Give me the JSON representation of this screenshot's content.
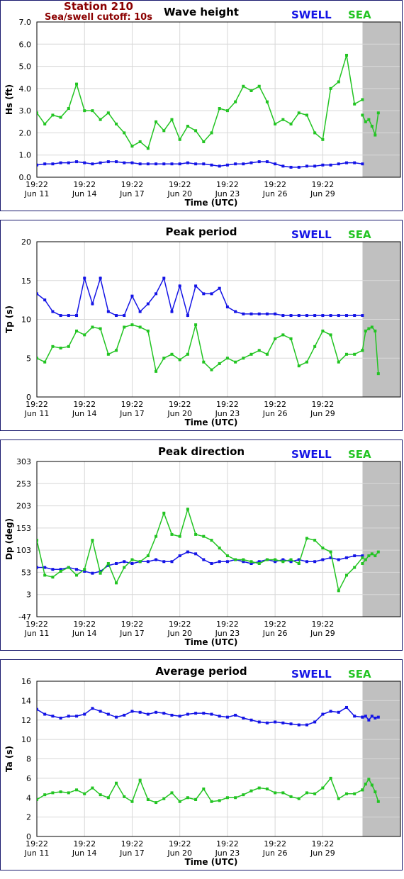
{
  "header": {
    "station": "Station 210",
    "cutoff": "Sea/swell cutoff: 10s"
  },
  "colors": {
    "swell": "#1414e6",
    "sea": "#22c422",
    "plot_bg": "#ffffff",
    "outside_bg": "#c0c0c0"
  },
  "legend": {
    "swell": "SWELL",
    "sea": "SEA"
  },
  "x_ticks": [
    {
      "time": "19:22",
      "date": "Jun 11"
    },
    {
      "time": "19:22",
      "date": "Jun 14"
    },
    {
      "time": "19:22",
      "date": "Jun 17"
    },
    {
      "time": "19:22",
      "date": "Jun 20"
    },
    {
      "time": "19:22",
      "date": "Jun 23"
    },
    {
      "time": "19:22",
      "date": "Jun 26"
    },
    {
      "time": "19:22",
      "date": "Jun 29"
    }
  ],
  "chart_data": [
    {
      "type": "line",
      "title": "Wave height",
      "ylabel": "Hs (ft)",
      "xlabel": "Time (UTC)",
      "ylim": [
        0,
        7
      ],
      "yticks": [
        "0.0",
        "1.0",
        "2.0",
        "3.0",
        "4.0",
        "5.0",
        "6.0",
        "7.0"
      ],
      "x": [
        0,
        0.5,
        1,
        1.5,
        2,
        2.5,
        3,
        3.5,
        4,
        4.5,
        5,
        5.5,
        6,
        6.5,
        7,
        7.5,
        8,
        8.5,
        9,
        9.5,
        10,
        10.5,
        11,
        11.5,
        12,
        12.5,
        13,
        13.5,
        14,
        14.5,
        15,
        15.5,
        16,
        16.5,
        17,
        17.5,
        18,
        18.5,
        19,
        19.5,
        20,
        20.5
      ],
      "series": [
        {
          "name": "SWELL",
          "values": [
            0.55,
            0.6,
            0.6,
            0.65,
            0.65,
            0.7,
            0.65,
            0.6,
            0.65,
            0.7,
            0.7,
            0.65,
            0.65,
            0.6,
            0.6,
            0.6,
            0.6,
            0.6,
            0.6,
            0.65,
            0.6,
            0.6,
            0.55,
            0.5,
            0.55,
            0.6,
            0.6,
            0.65,
            0.7,
            0.7,
            0.6,
            0.5,
            0.45,
            0.45,
            0.5,
            0.5,
            0.55,
            0.55,
            0.6,
            0.65,
            0.65,
            0.6
          ]
        },
        {
          "name": "SEA",
          "values": [
            2.9,
            2.4,
            2.8,
            2.7,
            3.1,
            4.2,
            3.0,
            3.0,
            2.6,
            2.9,
            2.4,
            2.0,
            1.4,
            1.6,
            1.3,
            2.5,
            2.1,
            2.6,
            1.7,
            2.3,
            2.1,
            1.6,
            2.0,
            3.1,
            3.0,
            3.4,
            4.1,
            3.9,
            4.1,
            3.4,
            2.4,
            2.6,
            2.4,
            2.9,
            2.8,
            2.0,
            1.7,
            4.0,
            4.3,
            5.5,
            3.3,
            3.5
          ]
        }
      ],
      "sea_tail": [
        2.8,
        2.5,
        2.6,
        2.3,
        1.9,
        2.9
      ]
    },
    {
      "type": "line",
      "title": "Peak period",
      "ylabel": "Tp (s)",
      "xlabel": "Time (UTC)",
      "ylim": [
        0,
        20
      ],
      "yticks": [
        "0",
        "5",
        "10",
        "15",
        "20"
      ],
      "x": [
        0,
        0.5,
        1,
        1.5,
        2,
        2.5,
        3,
        3.5,
        4,
        4.5,
        5,
        5.5,
        6,
        6.5,
        7,
        7.5,
        8,
        8.5,
        9,
        9.5,
        10,
        10.5,
        11,
        11.5,
        12,
        12.5,
        13,
        13.5,
        14,
        14.5,
        15,
        15.5,
        16,
        16.5,
        17,
        17.5,
        18,
        18.5,
        19,
        19.5,
        20,
        20.5
      ],
      "series": [
        {
          "name": "SWELL",
          "values": [
            13.3,
            12.5,
            11.0,
            10.5,
            10.5,
            10.5,
            15.3,
            12.0,
            15.3,
            11.0,
            10.5,
            10.5,
            13.0,
            11.0,
            12.0,
            13.3,
            15.3,
            11.0,
            14.3,
            10.5,
            14.3,
            13.3,
            13.3,
            14.0,
            11.6,
            11.0,
            10.7,
            10.7,
            10.7,
            10.7,
            10.7,
            10.5,
            10.5,
            10.5,
            10.5,
            10.5,
            10.5,
            10.5,
            10.5,
            10.5,
            10.5,
            10.5
          ]
        },
        {
          "name": "SEA",
          "values": [
            5.0,
            4.5,
            6.5,
            6.3,
            6.5,
            8.5,
            8.0,
            9.0,
            8.8,
            5.5,
            6.0,
            9.0,
            9.3,
            9.0,
            8.5,
            3.3,
            5.0,
            5.5,
            4.8,
            5.5,
            9.3,
            4.5,
            3.5,
            4.3,
            5.0,
            4.5,
            5.0,
            5.5,
            6.0,
            5.5,
            7.5,
            8.0,
            7.5,
            4.0,
            4.5,
            6.5,
            8.5,
            8.0,
            4.5,
            5.5,
            5.5,
            6.0
          ]
        }
      ],
      "sea_tail": [
        6.0,
        8.5,
        8.8,
        9.0,
        8.5,
        3.0
      ]
    },
    {
      "type": "line",
      "title": "Peak direction",
      "ylabel": "Dp (deg)",
      "xlabel": "Time (UTC)",
      "ylim": [
        -47,
        353
      ],
      "yticks": [
        "-47",
        "3",
        "53",
        "103",
        "153",
        "203",
        "253",
        "303"
      ],
      "x": [
        0,
        0.5,
        1,
        1.5,
        2,
        2.5,
        3,
        3.5,
        4,
        4.5,
        5,
        5.5,
        6,
        6.5,
        7,
        7.5,
        8,
        8.5,
        9,
        9.5,
        10,
        10.5,
        11,
        11.5,
        12,
        12.5,
        13,
        13.5,
        14,
        14.5,
        15,
        15.5,
        16,
        16.5,
        17,
        17.5,
        18,
        18.5,
        19,
        19.5,
        20,
        20.5
      ],
      "series": [
        {
          "name": "SWELL",
          "values": [
            80,
            80,
            75,
            75,
            80,
            75,
            70,
            65,
            70,
            85,
            90,
            95,
            90,
            95,
            95,
            100,
            95,
            95,
            110,
            120,
            115,
            100,
            90,
            95,
            95,
            100,
            95,
            90,
            95,
            100,
            95,
            100,
            95,
            100,
            95,
            95,
            100,
            105,
            100,
            105,
            110,
            110
          ]
        },
        {
          "name": "SEA",
          "values": [
            150,
            60,
            55,
            70,
            80,
            60,
            75,
            150,
            65,
            90,
            40,
            80,
            100,
            95,
            110,
            160,
            220,
            165,
            160,
            230,
            165,
            160,
            150,
            130,
            110,
            100,
            100,
            95,
            90,
            100,
            100,
            95,
            100,
            90,
            155,
            150,
            130,
            120,
            20,
            60,
            80,
            105
          ]
        },
        {
          "name": "",
          "values": []
        }
      ],
      "sea_tail": [
        90,
        100,
        110,
        115,
        110,
        120
      ]
    },
    {
      "type": "line",
      "title": "Average period",
      "ylabel": "Ta (s)",
      "xlabel": "Time (UTC)",
      "ylim": [
        0,
        16
      ],
      "yticks": [
        "0",
        "2",
        "4",
        "6",
        "8",
        "10",
        "12",
        "14",
        "16"
      ],
      "x": [
        0,
        0.5,
        1,
        1.5,
        2,
        2.5,
        3,
        3.5,
        4,
        4.5,
        5,
        5.5,
        6,
        6.5,
        7,
        7.5,
        8,
        8.5,
        9,
        9.5,
        10,
        10.5,
        11,
        11.5,
        12,
        12.5,
        13,
        13.5,
        14,
        14.5,
        15,
        15.5,
        16,
        16.5,
        17,
        17.5,
        18,
        18.5,
        19,
        19.5,
        20,
        20.5
      ],
      "series": [
        {
          "name": "SWELL",
          "values": [
            13.1,
            12.6,
            12.4,
            12.2,
            12.4,
            12.4,
            12.6,
            13.2,
            12.9,
            12.6,
            12.3,
            12.5,
            12.9,
            12.8,
            12.6,
            12.8,
            12.7,
            12.5,
            12.4,
            12.6,
            12.7,
            12.7,
            12.6,
            12.4,
            12.3,
            12.5,
            12.2,
            12.0,
            11.8,
            11.7,
            11.8,
            11.7,
            11.6,
            11.5,
            11.5,
            11.8,
            12.6,
            12.9,
            12.8,
            13.3,
            12.4,
            12.3
          ]
        },
        {
          "name": "SEA",
          "values": [
            3.8,
            4.3,
            4.5,
            4.6,
            4.5,
            4.8,
            4.4,
            5.0,
            4.3,
            4.0,
            5.5,
            4.1,
            3.6,
            5.8,
            3.8,
            3.5,
            3.9,
            4.5,
            3.6,
            4.0,
            3.8,
            4.9,
            3.6,
            3.7,
            4.0,
            4.0,
            4.3,
            4.7,
            5.0,
            4.9,
            4.5,
            4.5,
            4.1,
            3.9,
            4.5,
            4.4,
            5.0,
            6.0,
            3.9,
            4.4,
            4.4,
            4.8
          ]
        }
      ],
      "swell_tail": [
        12.3,
        12.4,
        12.0,
        12.4,
        12.2,
        12.3
      ],
      "sea_tail": [
        4.8,
        5.4,
        5.9,
        5.3,
        4.6,
        3.6
      ]
    }
  ]
}
